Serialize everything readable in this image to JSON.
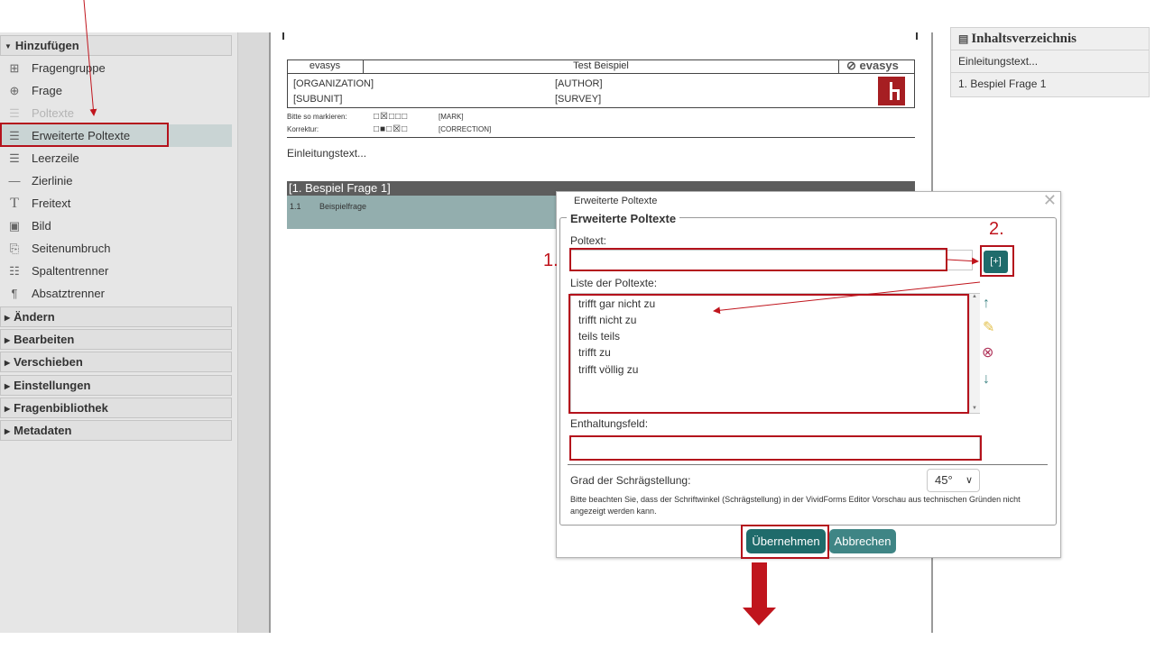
{
  "sidebar": {
    "sections": [
      {
        "label": "Hinzufügen",
        "expanded": true
      },
      {
        "label": "Ändern"
      },
      {
        "label": "Bearbeiten"
      },
      {
        "label": "Verschieben"
      },
      {
        "label": "Einstellungen"
      },
      {
        "label": "Fragenbibliothek"
      },
      {
        "label": "Metadaten"
      }
    ],
    "items": [
      {
        "label": "Fragengruppe",
        "icon": "question-group-icon"
      },
      {
        "label": "Frage",
        "icon": "add-question-icon"
      },
      {
        "label": "Poltexte",
        "icon": "pole-text-icon"
      },
      {
        "label": "Erweiterte Poltexte",
        "icon": "extended-pole-text-icon"
      },
      {
        "label": "Leerzeile",
        "icon": "blank-line-icon"
      },
      {
        "label": "Zierlinie",
        "icon": "decorative-line-icon"
      },
      {
        "label": "Freitext",
        "icon": "free-text-icon"
      },
      {
        "label": "Bild",
        "icon": "image-icon"
      },
      {
        "label": "Seitenumbruch",
        "icon": "page-break-icon"
      },
      {
        "label": "Spaltentrenner",
        "icon": "column-separator-icon"
      },
      {
        "label": "Absatztrenner",
        "icon": "paragraph-separator-icon"
      }
    ]
  },
  "document": {
    "header_left": "evasys",
    "header_center": "Test Beispiel",
    "header_logo": "evasys",
    "organization": "[ORGANIZATION]",
    "subunit": "[SUBUNIT]",
    "author": "[AUTHOR]",
    "survey": "[SURVEY]",
    "mark_label": "Bitte so markieren:",
    "mark_placeholder": "[MARK]",
    "correction_label": "Korrektur:",
    "correction_placeholder": "[CORRECTION]",
    "intro_text": "Einleitungstext...",
    "question_group": "[1. Bespiel Frage 1]",
    "question_number": "1.1",
    "question_text": "Beispielfrage"
  },
  "toc": {
    "title": "Inhaltsverzeichnis",
    "items": [
      "Einleitungstext...",
      "1. Bespiel Frage 1"
    ]
  },
  "dialog": {
    "title": "Erweiterte Poltexte",
    "legend": "Erweiterte Poltexte",
    "poltext_label": "Poltext:",
    "poltext_value": "",
    "add_button": "[+]",
    "list_label": "Liste der Poltexte:",
    "list_items": [
      "trifft gar nicht zu",
      "trifft nicht zu",
      "teils teils",
      "trifft zu",
      "trifft völlig zu"
    ],
    "abstention_label": "Enthaltungsfeld:",
    "abstention_value": "",
    "slant_label": "Grad der Schrägstellung:",
    "slant_value": "45°",
    "note": "Bitte beachten Sie, dass der Schriftwinkel (Schrägstellung) in der VividForms Editor Vorschau aus technischen Gründen nicht angezeigt werden kann.",
    "apply_button": "Übernehmen",
    "cancel_button": "Abbrechen"
  },
  "annotations": {
    "step1": "1.",
    "step2": "2."
  },
  "colors": {
    "accent": "#1f6b6b",
    "cancel": "#3f8585",
    "highlight": "#b4121c",
    "active_item": "#c9d4d4"
  }
}
